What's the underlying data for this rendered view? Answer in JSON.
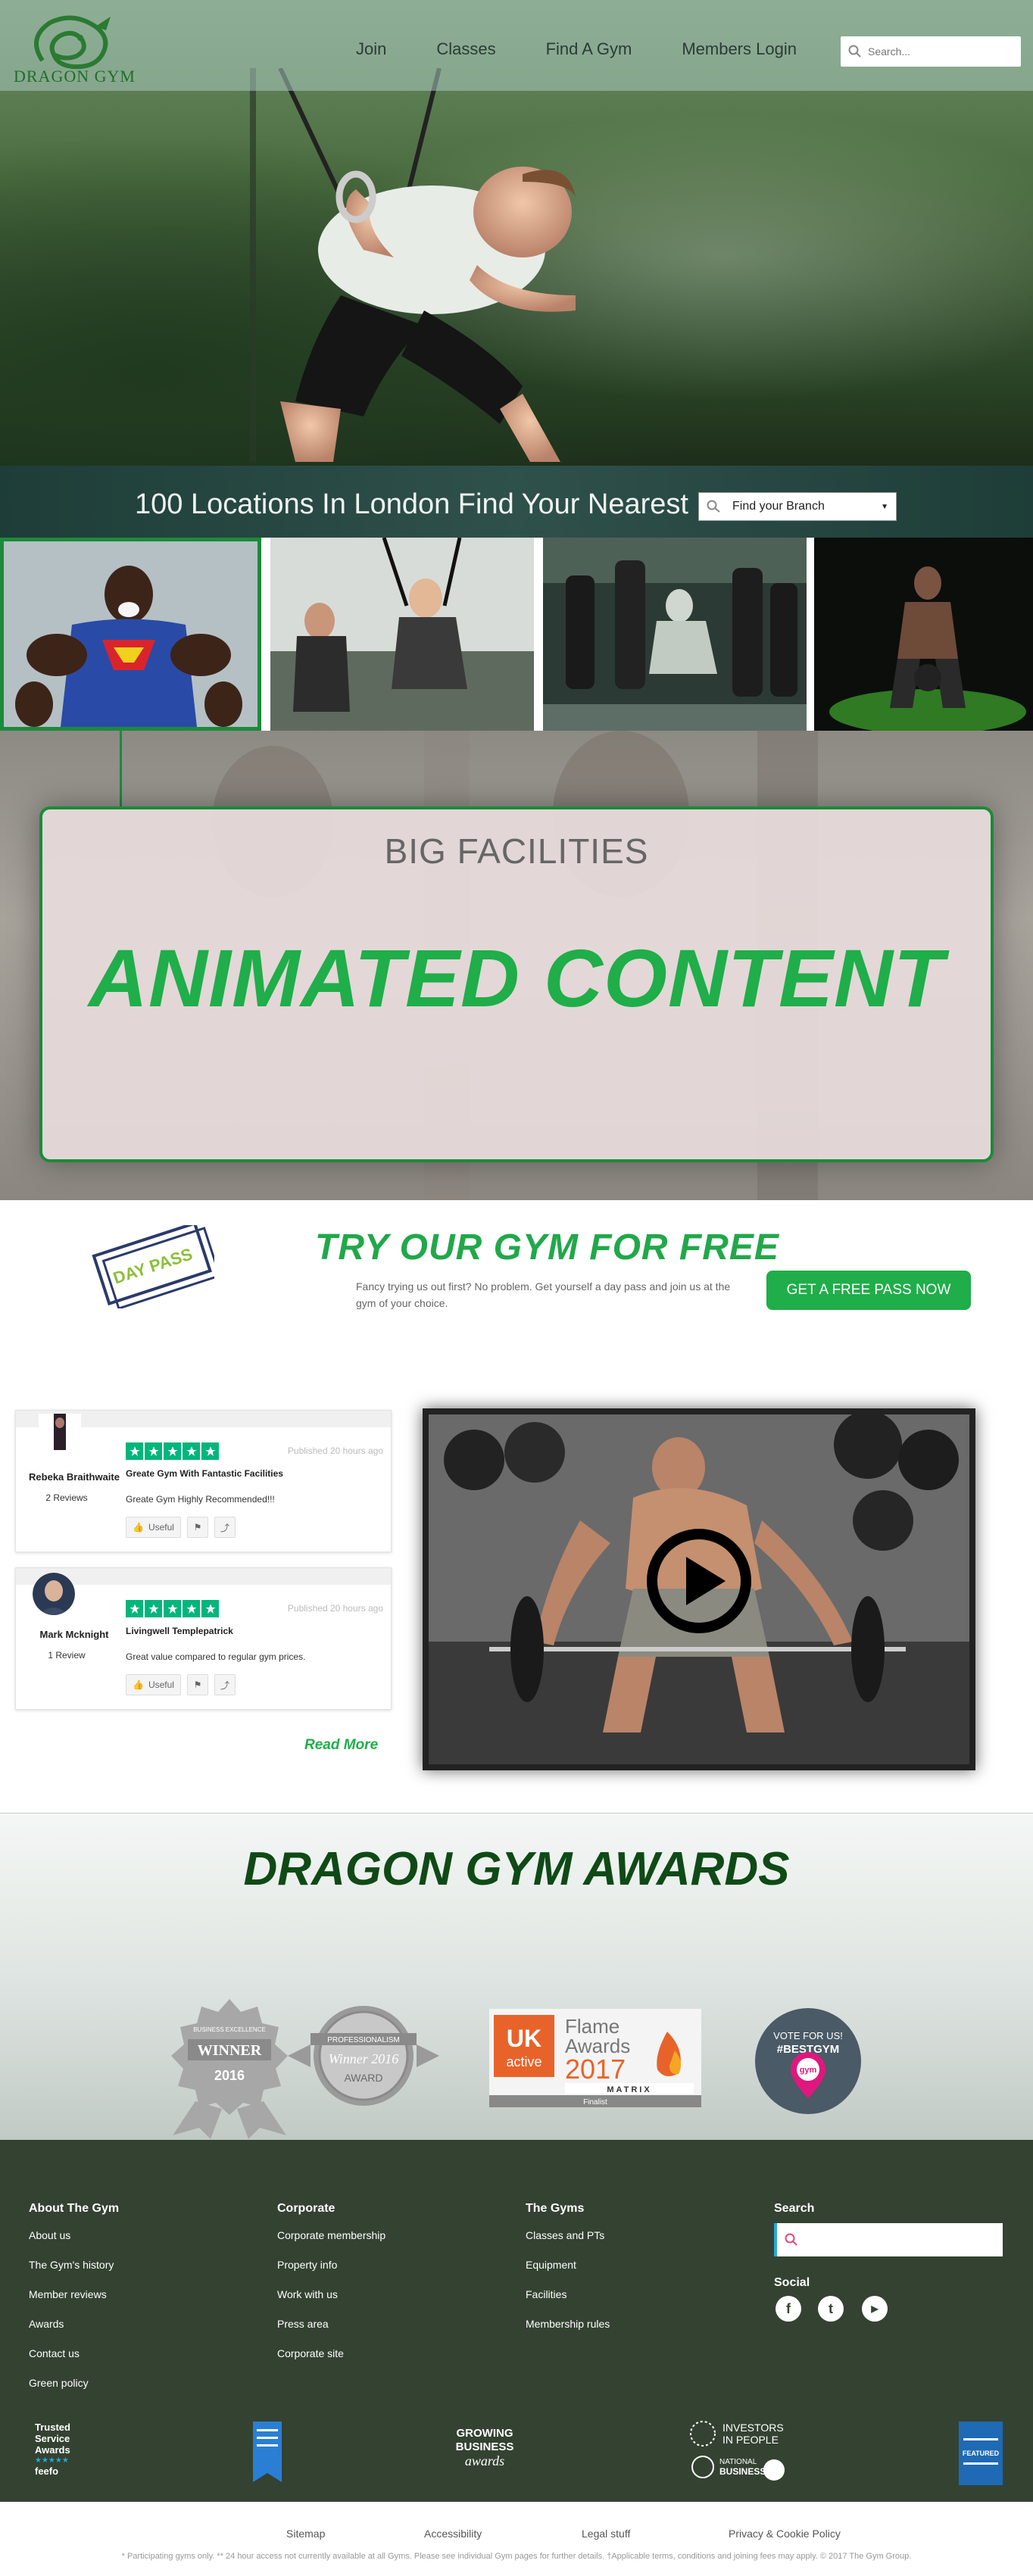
{
  "brand": {
    "name": "DRAGON GYM",
    "accent": "#1fae49",
    "dark_green": "#0f4a16",
    "footer_bg": "#344232"
  },
  "nav": {
    "items": [
      {
        "label": "Join"
      },
      {
        "label": "Classes"
      },
      {
        "label": "Find A Gym"
      },
      {
        "label": "Members Login"
      }
    ],
    "search_placeholder": "Search..."
  },
  "locations": {
    "title": "100 Locations In London Find Your Nearest",
    "select_value": "Find your Branch"
  },
  "facilities": {
    "title": "BIG FACILITIES",
    "animated_text": "ANIMATED CONTENT"
  },
  "day_pass": {
    "ticket_text": "DAY PASS",
    "title": "TRY OUR GYM FOR FREE",
    "text": "Fancy trying us out first? No problem. Get yourself a day pass and join us at the gym of your choice.",
    "button": "GET A FREE PASS NOW"
  },
  "reviews": [
    {
      "name": "Rebeka Braithwaite",
      "count": "2 Reviews",
      "rating": 5,
      "published": "Published 20 hours ago",
      "title": "Greate Gym With Fantastic Facilities",
      "body": "Greate Gym Highly Recommended!!!",
      "useful": "Useful"
    },
    {
      "name": "Mark Mcknight",
      "count": "1 Review",
      "rating": 5,
      "published": "Published 20 hours ago",
      "title": "Livingwell Templepatrick",
      "body": "Great value compared to regular gym prices.",
      "useful": "Useful"
    }
  ],
  "read_more": "Read More",
  "awards": {
    "title": "DRAGON GYM AWARDS",
    "items": [
      {
        "top": "BUSINESS EXCELLENCE",
        "main": "WINNER",
        "year": "2016"
      },
      {
        "top": "PROFESSIONALISM",
        "script": "Winner 2016",
        "main": "AWARD"
      },
      {
        "uk": "UK",
        "active": "active",
        "flame": "Flame",
        "awards": "Awards",
        "year": "2017",
        "matrix": "MATRIX",
        "finalist": "Finalist"
      },
      {
        "line1": "VOTE FOR US!",
        "line2": "#BESTGYM",
        "pin": "gym"
      }
    ]
  },
  "footer": {
    "columns": [
      {
        "heading": "About The Gym",
        "links": [
          "About us",
          "The Gym's history",
          "Member reviews",
          "Awards",
          "Contact us",
          "Green policy"
        ]
      },
      {
        "heading": "Corporate",
        "links": [
          "Corporate membership",
          "Property info",
          "Work with us",
          "Press area",
          "Corporate site"
        ]
      },
      {
        "heading": "The Gyms",
        "links": [
          "Classes and PTs",
          "Equipment",
          "Facilities",
          "Membership rules"
        ]
      }
    ],
    "search_label": "Search",
    "social_label": "Social",
    "social": [
      {
        "icon": "facebook-icon",
        "glyph": "f"
      },
      {
        "icon": "twitter-icon",
        "glyph": "t"
      },
      {
        "icon": "youtube-icon",
        "glyph": "▶"
      }
    ],
    "badges": {
      "trusted": [
        "Trusted",
        "Service",
        "Awards",
        "feefo"
      ],
      "growing": [
        "GROWING",
        "BUSINESS",
        "awards"
      ],
      "investors": [
        "INVESTORS",
        "IN PEOPLE",
        "NATIONAL",
        "BUSINESS"
      ],
      "featured": [
        "FEATURED"
      ]
    }
  },
  "bottom": {
    "links": [
      "Sitemap",
      "Accessibility",
      "Legal stuff",
      "Privacy & Cookie Policy"
    ],
    "note": "* Participating gyms only. ** 24 hour access not currently available at all Gyms. Please see individual Gym pages for further details. †Applicable terms, conditions and joining fees may apply. © 2017 The Gym Group."
  }
}
